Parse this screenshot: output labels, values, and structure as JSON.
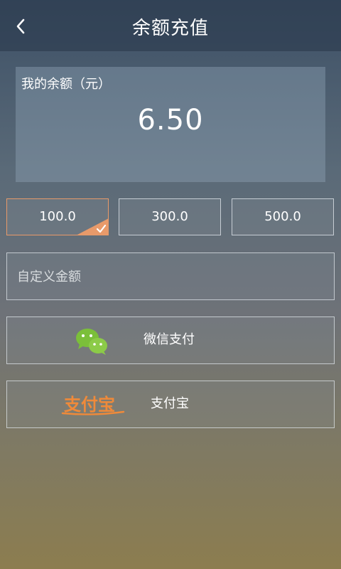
{
  "header": {
    "title": "余额充值",
    "back_icon": "chevron-left-icon"
  },
  "balance": {
    "label": "我的余额（元）",
    "value": "6.50"
  },
  "amounts": [
    {
      "label": "100.0",
      "selected": true
    },
    {
      "label": "300.0",
      "selected": false
    },
    {
      "label": "500.0",
      "selected": false
    }
  ],
  "custom_amount": {
    "placeholder": "自定义金额",
    "value": ""
  },
  "payment_methods": [
    {
      "label": "微信支付",
      "icon": "wechat-icon",
      "color": "#7bbf3a"
    },
    {
      "label": "支付宝",
      "icon": "alipay-icon",
      "logo_text": "支付宝",
      "color": "#ef8a3a"
    }
  ],
  "colors": {
    "selected_border": "#e89a6a",
    "check_corner": "#e89a6a"
  }
}
